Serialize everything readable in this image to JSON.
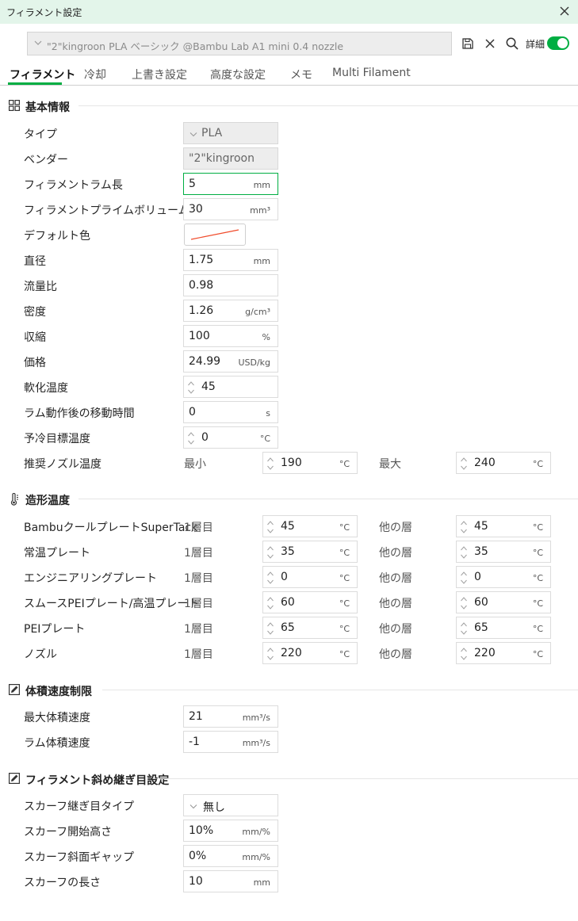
{
  "window": {
    "title": "フィラメント設定"
  },
  "preset": {
    "value": "\"2\"kingroon PLA ベーシック @Bambu Lab A1 mini 0.4 nozzle"
  },
  "toolbar": {
    "detail_label": "詳細"
  },
  "tabs": [
    {
      "label": "フィラメント",
      "active": true
    },
    {
      "label": "冷却"
    },
    {
      "label": "上書き設定"
    },
    {
      "label": "高度な設定"
    },
    {
      "label": "メモ"
    },
    {
      "label": "Multi Filament"
    }
  ],
  "basic": {
    "title": "基本情報",
    "type": {
      "label": "タイプ",
      "value": "PLA"
    },
    "vendor": {
      "label": "ベンダー",
      "value": "\"2\"kingroon"
    },
    "ram_length": {
      "label": "フィラメントラム長",
      "value": "5",
      "unit": "mm"
    },
    "prime_volume": {
      "label": "フィラメントプライムボリューム",
      "value": "30",
      "unit": "mm³"
    },
    "default_color": {
      "label": "デフォルト色",
      "color": "#f04a2a"
    },
    "diameter": {
      "label": "直径",
      "value": "1.75",
      "unit": "mm"
    },
    "flow_ratio": {
      "label": "流量比",
      "value": "0.98"
    },
    "density": {
      "label": "密度",
      "value": "1.26",
      "unit": "g/cm³"
    },
    "shrinkage": {
      "label": "収縮",
      "value": "100",
      "unit": "%"
    },
    "price": {
      "label": "価格",
      "value": "24.99",
      "unit": "USD/kg"
    },
    "softening_temp": {
      "label": "軟化温度",
      "value": "45"
    },
    "ram_travel_time": {
      "label": "ラム動作後の移動時間",
      "value": "0",
      "unit": "s"
    },
    "precool_temp": {
      "label": "予冷目標温度",
      "value": "0",
      "unit": "°C"
    },
    "nozzle_temp_range": {
      "label": "推奨ノズル温度",
      "min_label": "最小",
      "min": "190",
      "max_label": "最大",
      "max": "240",
      "unit": "°C"
    }
  },
  "print_temp": {
    "title": "造形温度",
    "first_layer_label": "1層目",
    "other_layer_label": "他の層",
    "unit": "°C",
    "rows": [
      {
        "label": "BambuクールプレートSuperTack",
        "first": "45",
        "other": "45"
      },
      {
        "label": "常温プレート",
        "first": "35",
        "other": "35"
      },
      {
        "label": "エンジニアリングプレート",
        "first": "0",
        "other": "0"
      },
      {
        "label": "スムースPEIプレート/高温プレート",
        "first": "60",
        "other": "60"
      },
      {
        "label": "PEIプレート",
        "first": "65",
        "other": "65"
      },
      {
        "label": "ノズル",
        "first": "220",
        "other": "220"
      }
    ]
  },
  "volumetric": {
    "title": "体積速度制限",
    "max_speed": {
      "label": "最大体積速度",
      "value": "21",
      "unit": "mm³/s"
    },
    "ram_speed": {
      "label": "ラム体積速度",
      "value": "-1",
      "unit": "mm³/s"
    }
  },
  "scarf": {
    "title": "フィラメント斜め継ぎ目設定",
    "type": {
      "label": "スカーフ継ぎ目タイプ",
      "value": "無し"
    },
    "start_height": {
      "label": "スカーフ開始高さ",
      "value": "10%",
      "unit": "mm/%"
    },
    "slope_gap": {
      "label": "スカーフ斜面ギャップ",
      "value": "0%",
      "unit": "mm/%"
    },
    "length": {
      "label": "スカーフの長さ",
      "value": "10",
      "unit": "mm"
    }
  }
}
